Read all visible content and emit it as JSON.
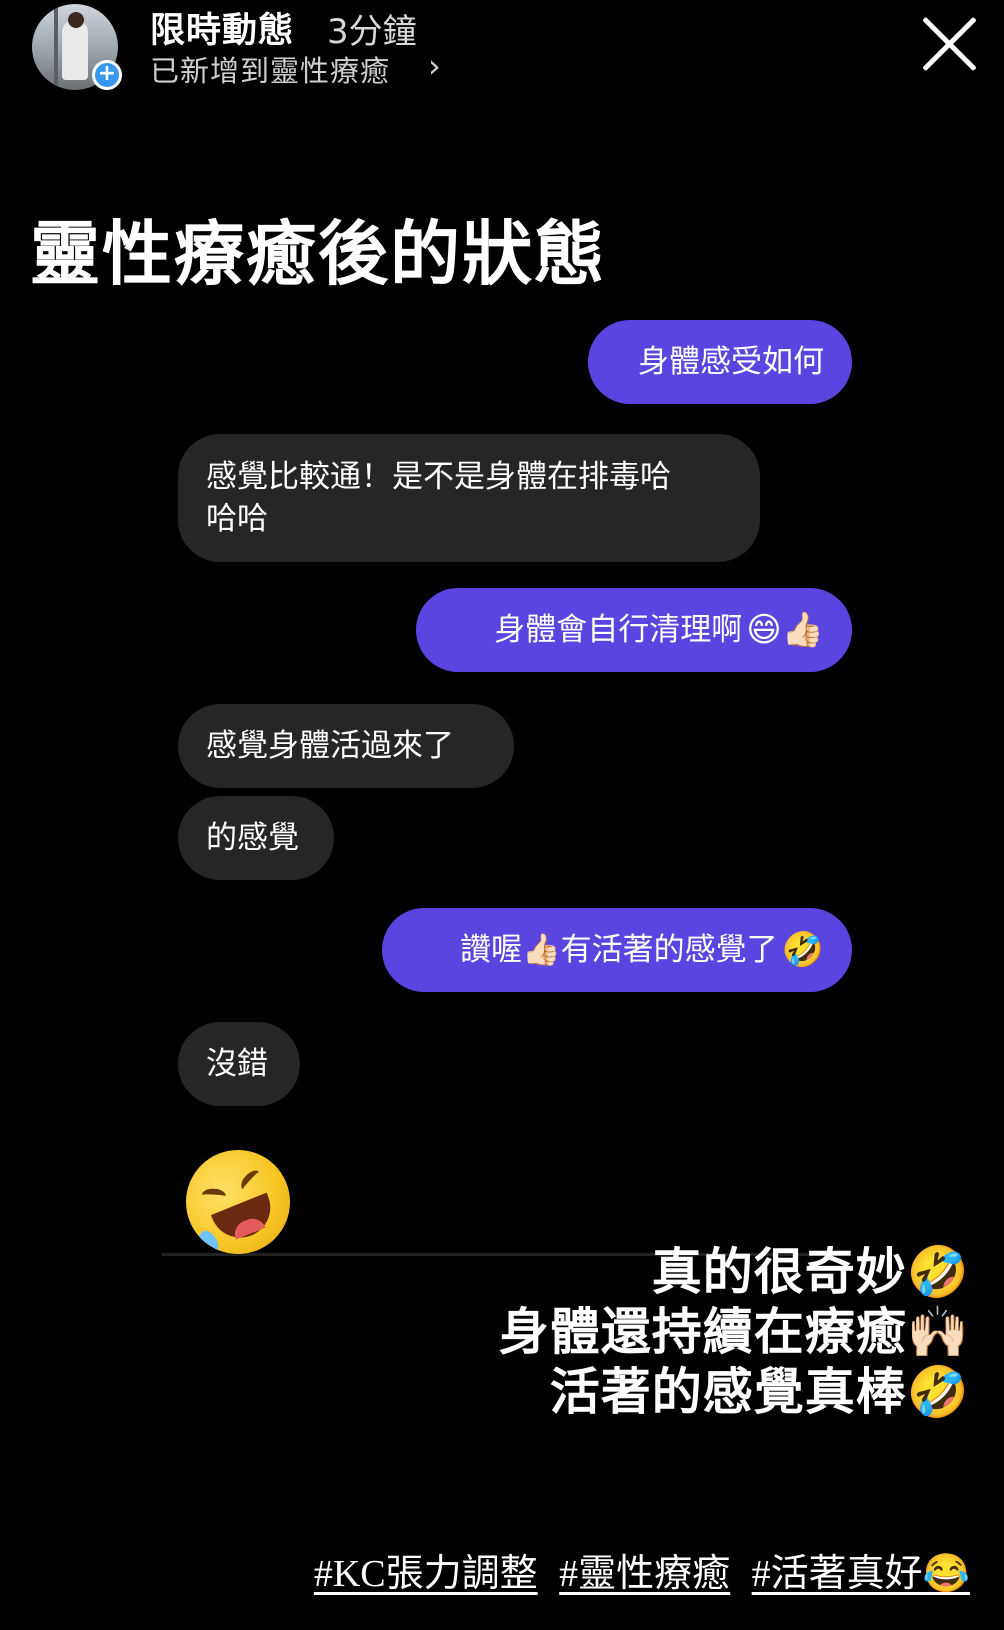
{
  "header": {
    "title": "限時動態",
    "time": "3分鐘",
    "added_to": "已新增到靈性療癒",
    "chevron": "›"
  },
  "story": {
    "heading": "靈性療癒後的狀態",
    "chat": [
      {
        "side": "out",
        "text": "身體感受如何",
        "emoji": ""
      },
      {
        "side": "in",
        "text": "感覺比較通！是不是身體在排毒哈\n哈哈",
        "emoji": ""
      },
      {
        "side": "out",
        "text": "身體會自行清理啊",
        "emoji": "😄👍🏻"
      },
      {
        "side": "in",
        "text": "感覺身體活過來了",
        "emoji": ""
      },
      {
        "side": "in",
        "text": "的感覺",
        "emoji": ""
      },
      {
        "side": "out",
        "text": "讚喔👍🏻有活著的感覺了",
        "emoji": "🤣"
      },
      {
        "side": "in",
        "text": "沒錯",
        "emoji": ""
      }
    ],
    "laugh_emoji_icon": "rolling-on-floor-laughing-icon",
    "caption": [
      "真的很奇妙🤣",
      "身體還持續在療癒🙌🏻",
      "活著的感覺真棒🤣"
    ],
    "hashtags": [
      "#KC張力調整",
      "#靈性療癒",
      "#活著真好😂"
    ]
  },
  "colors": {
    "background": "#000000",
    "outgoing_bubble": "#5b45e0",
    "incoming_bubble": "#262626",
    "badge": "#3897f0"
  }
}
